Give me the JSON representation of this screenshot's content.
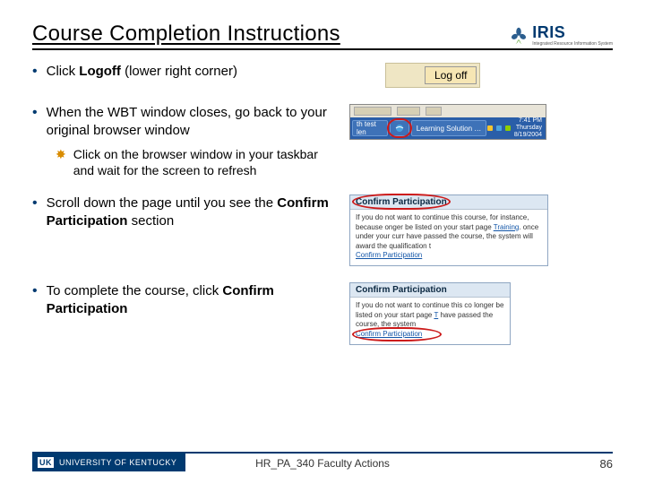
{
  "header": {
    "title": "Course Completion Instructions",
    "logo_text": "IRIS",
    "logo_sub": "Integrated Resource Information System"
  },
  "bullets": [
    {
      "pre": "Click ",
      "bold": "Logoff",
      "post": " (lower right corner)"
    },
    {
      "text": "When the WBT window closes, go back to your original browser window",
      "sub": "Click on the browser window in your taskbar and wait for the screen to refresh"
    },
    {
      "pre": "Scroll down the page until you see the ",
      "bold": "Confirm Participation",
      "post": " section"
    },
    {
      "pre": "To complete the course, click ",
      "bold": "Confirm Participation",
      "post": ""
    }
  ],
  "shots": {
    "logoff_label": "Log off",
    "taskbar": {
      "item_test": "th test len",
      "item_learn": "Learning Solution …",
      "time": "7:41 PM",
      "date": "Thursday",
      "date2": "8/19/2004"
    },
    "confirm1": {
      "header": "Confirm Participation",
      "body1": "If you do not want to continue this course, for instance, because onger be listed on your start page ",
      "link_inline": "Training",
      "body1b": ". once under your curr have passed the course, the system will award the qualification t",
      "link": "Confirm Participation"
    },
    "confirm2": {
      "header": "Confirm Participation",
      "body1": "If you do not want to continue this co longer be listed on your start page ",
      "link_inline": "T",
      "body1b": " have passed the course, the system",
      "link": "Confirm Participation"
    }
  },
  "footer": {
    "org": "UNIVERSITY OF KENTUCKY",
    "uk": "UK",
    "center": "HR_PA_340 Faculty Actions",
    "page": "86"
  }
}
